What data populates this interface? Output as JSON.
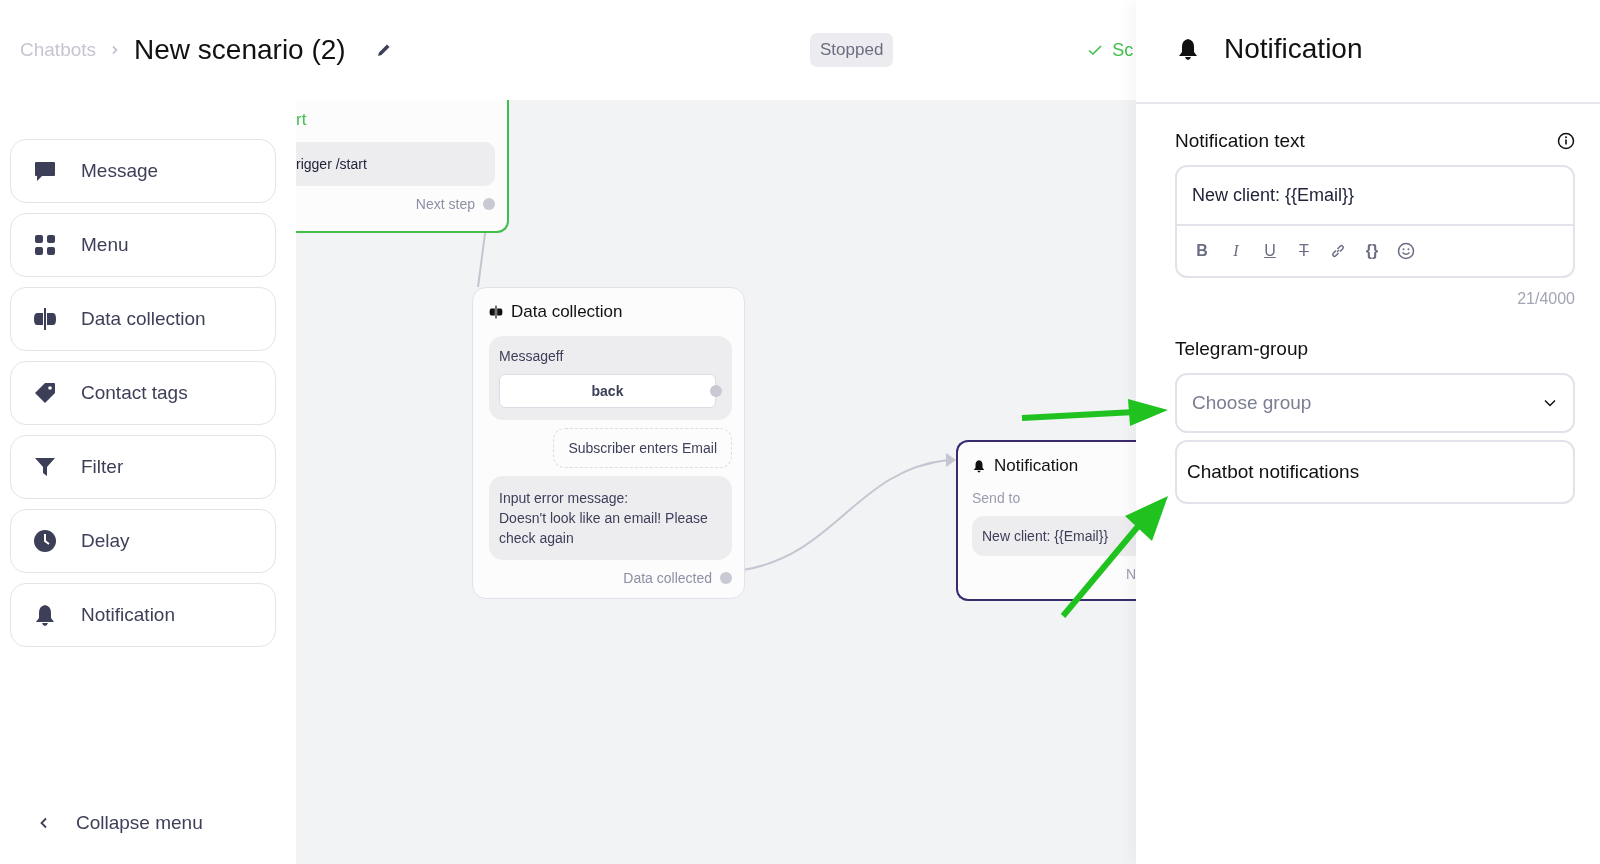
{
  "header": {
    "breadcrumb_parent": "Chatbots",
    "title": "New scenario (2)",
    "status_badge": "Stopped",
    "save_status": "Sc"
  },
  "sidebar": {
    "items": [
      {
        "label": "Message",
        "kind": "message"
      },
      {
        "label": "Menu",
        "kind": "menu"
      },
      {
        "label": "Data collection",
        "kind": "data"
      },
      {
        "label": "Contact tags",
        "kind": "tags"
      },
      {
        "label": "Filter",
        "kind": "filter"
      },
      {
        "label": "Delay",
        "kind": "delay"
      },
      {
        "label": "Notification",
        "kind": "notification"
      }
    ],
    "collapse_label": "Collapse menu"
  },
  "canvas": {
    "start_node": {
      "title": "rt",
      "trigger": "rigger /start",
      "output": "Next step"
    },
    "data_node": {
      "title": "Data collection",
      "message_label": "Messageff",
      "button": "back",
      "input_label": "Subscriber enters Email",
      "error_label": "Input error message:",
      "error_text": "Doesn't look like an email! Please check again",
      "output": "Data collected"
    },
    "notification_node": {
      "title": "Notification",
      "label": "Send to",
      "text": "New client: {{Email}}",
      "output": "N"
    }
  },
  "panel": {
    "title": "Notification",
    "text_label": "Notification text",
    "text_value": "New client: {{Email}}",
    "toolbar": [
      {
        "kind": "bold",
        "glyph": "B"
      },
      {
        "kind": "italic",
        "glyph": "I"
      },
      {
        "kind": "underline",
        "glyph": "U"
      },
      {
        "kind": "strike",
        "glyph": "T"
      },
      {
        "kind": "link"
      },
      {
        "kind": "braces",
        "glyph": "{}"
      },
      {
        "kind": "emoji"
      }
    ],
    "counter": "21/4000",
    "group_label": "Telegram-group",
    "group_placeholder": "Choose group",
    "option": "Chatbot notifications"
  }
}
